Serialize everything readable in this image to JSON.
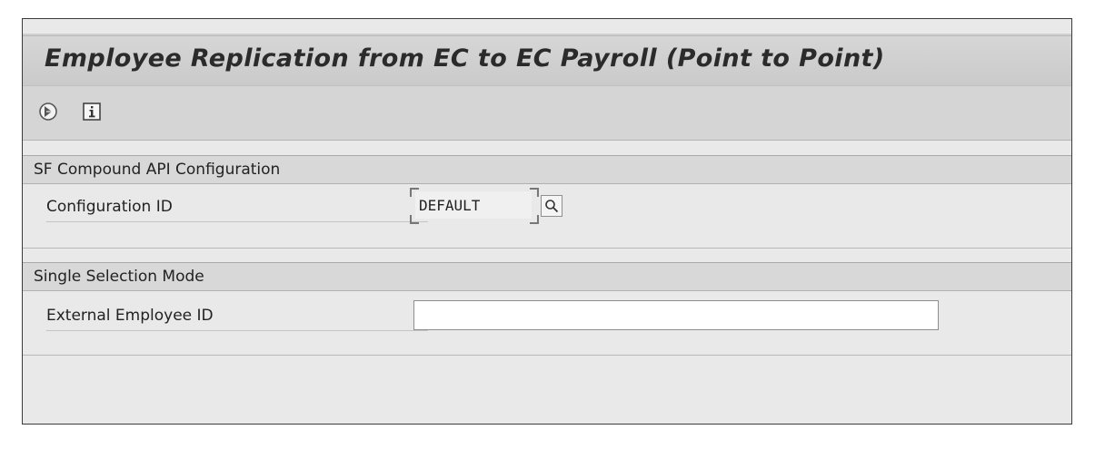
{
  "title": "Employee Replication from EC to EC Payroll (Point to Point)",
  "toolbar": {
    "icons": [
      "execute-icon",
      "info-icon"
    ]
  },
  "sections": [
    {
      "header": "SF Compound API Configuration",
      "fields": [
        {
          "label": "Configuration ID",
          "value": "DEFAULT",
          "has_search_help": true
        }
      ]
    },
    {
      "header": "Single Selection Mode",
      "fields": [
        {
          "label": "External Employee ID",
          "value": ""
        }
      ]
    }
  ],
  "colors": {
    "title_bar": "#cacaca",
    "toolbar": "#d5d5d5",
    "section_header": "#d8d8d8",
    "body": "#e9e9e9"
  }
}
